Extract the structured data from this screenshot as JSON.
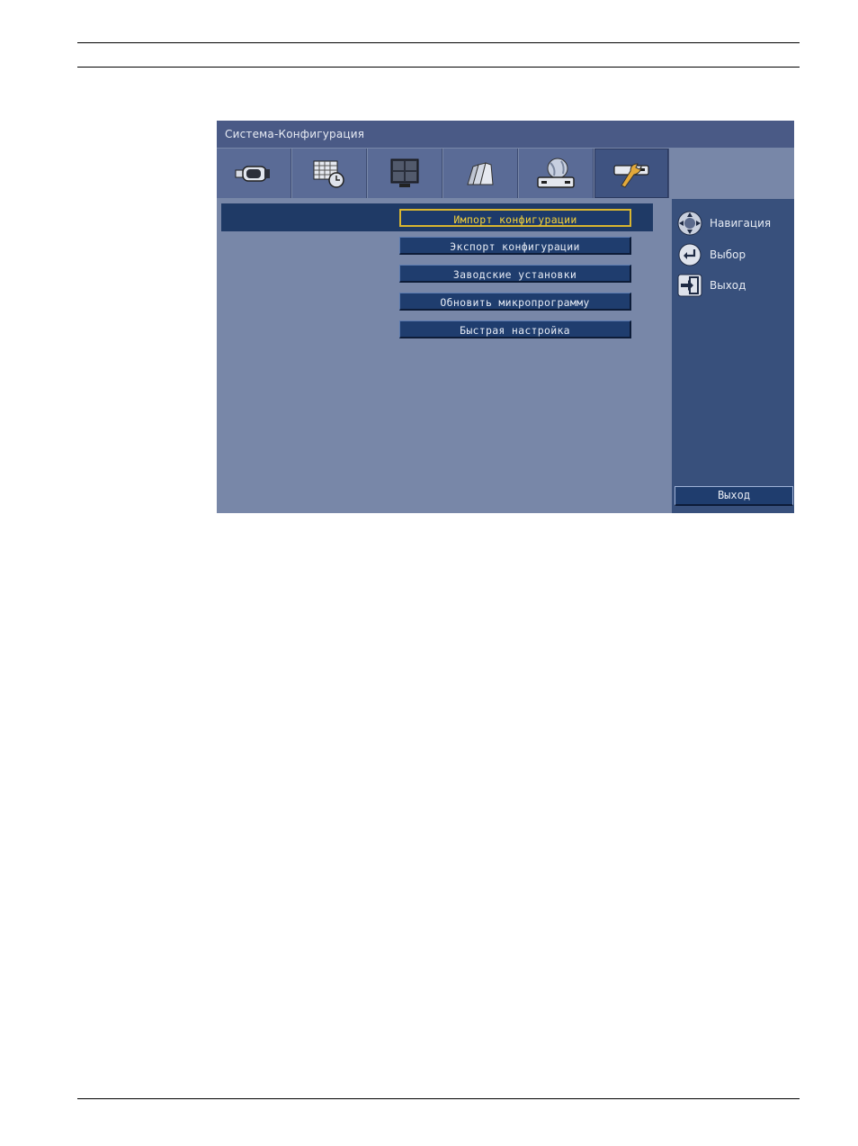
{
  "window": {
    "title": "Система-Конфигурация"
  },
  "tabs": [
    {
      "icon": "camera-icon",
      "active": false
    },
    {
      "icon": "schedule-icon",
      "active": false
    },
    {
      "icon": "monitor-icon",
      "active": false
    },
    {
      "icon": "archive-icon",
      "active": false
    },
    {
      "icon": "network-icon",
      "active": false
    },
    {
      "icon": "tools-icon",
      "active": true
    }
  ],
  "menu": {
    "items": [
      {
        "label": "Импорт конфигурации",
        "focused": true
      },
      {
        "label": "Экспорт конфигурации",
        "focused": false
      },
      {
        "label": "Заводские установки",
        "focused": false
      },
      {
        "label": "Обновить микропрограмму",
        "focused": false
      },
      {
        "label": "Быстрая настройка",
        "focused": false
      }
    ]
  },
  "help": {
    "navigation": {
      "label": "Навигация",
      "icon": "dpad-icon"
    },
    "select": {
      "label": "Выбор",
      "icon": "enter-icon"
    },
    "exit": {
      "label": "Выход",
      "icon": "exit-icon"
    }
  },
  "exit_button": {
    "label": "Выход"
  },
  "colors": {
    "focus_text": "#f4d23a",
    "panel_bg": "#7887a8",
    "title_bg": "#4a5a86",
    "button_bg": "#1f3d6e"
  }
}
